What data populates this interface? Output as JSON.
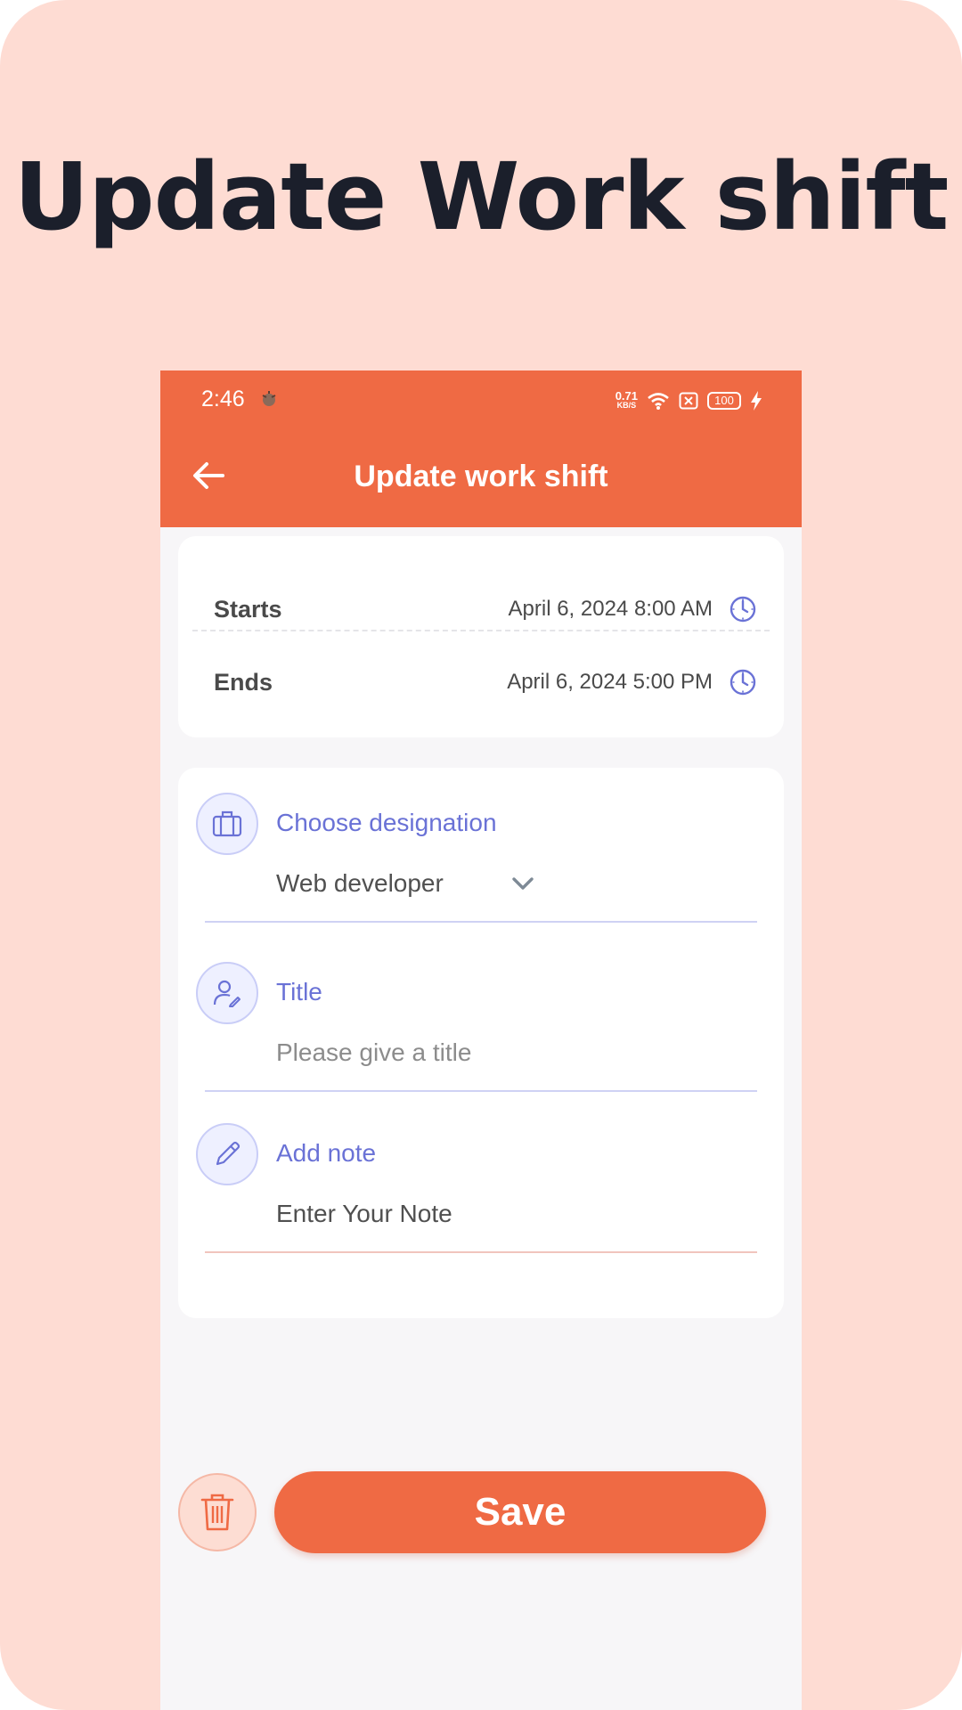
{
  "headline": "Update Work shift",
  "status_bar": {
    "time": "2:46",
    "speed_value": "0.71",
    "speed_unit": "KB/S",
    "battery": "100"
  },
  "app_bar": {
    "title": "Update work shift"
  },
  "schedule": {
    "starts_label": "Starts",
    "starts_value": "April 6, 2024 8:00 AM",
    "ends_label": "Ends",
    "ends_value": "April 6, 2024 5:00 PM"
  },
  "form": {
    "designation": {
      "label": "Choose designation",
      "value": "Web developer"
    },
    "title": {
      "label": "Title",
      "placeholder": "Please give a title"
    },
    "note": {
      "label": "Add note",
      "placeholder": "Enter Your Note"
    }
  },
  "actions": {
    "save_label": "Save"
  },
  "colors": {
    "brand": "#ef6a44",
    "accent": "#6a72d6",
    "background": "#fedcd3"
  },
  "icons": {
    "back": "arrow-left-icon",
    "clock": "clock-icon",
    "briefcase": "briefcase-icon",
    "user_edit": "user-edit-icon",
    "pencil": "pencil-icon",
    "trash": "trash-icon",
    "chevron": "chevron-down-icon"
  }
}
